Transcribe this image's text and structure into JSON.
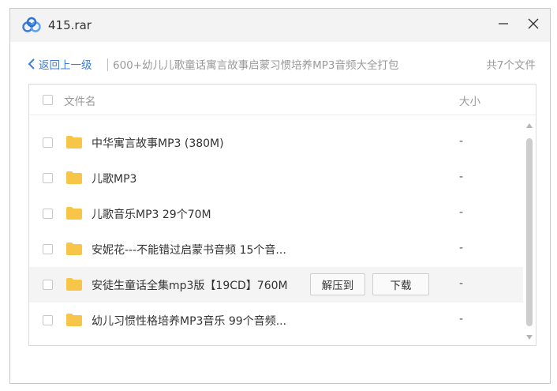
{
  "window": {
    "title": "415.rar",
    "controls": {
      "minimize_icon": "minimize-icon",
      "close_icon": "close-icon"
    }
  },
  "breadcrumb": {
    "back_label": "返回上一级",
    "path": "600+幼儿儿歌童话寓言故事启蒙习惯培养MP3音频大全打包",
    "count": "共7个文件"
  },
  "list": {
    "header": {
      "name": "文件名",
      "size": "大小"
    },
    "rows": [
      {
        "name": "中华寓言故事MP3 (380M)",
        "size": "-"
      },
      {
        "name": "儿歌MP3",
        "size": "-"
      },
      {
        "name": "儿歌音乐MP3 29个70M",
        "size": "-"
      },
      {
        "name": "安妮花---不能错过启蒙书音频 15个音...",
        "size": "-"
      },
      {
        "name": "安徒生童话全集mp3版【19CD】760M",
        "size": "-",
        "hovered": true
      },
      {
        "name": "幼儿习惯性格培养MP3音乐 99个音频...",
        "size": "-"
      }
    ],
    "row_actions": {
      "extract": "解压到",
      "download": "下载"
    }
  },
  "colors": {
    "accent": "#3d7bd6",
    "folder": "#f7c548",
    "muted_text": "#999999",
    "hover_row": "#f4f4f4"
  }
}
